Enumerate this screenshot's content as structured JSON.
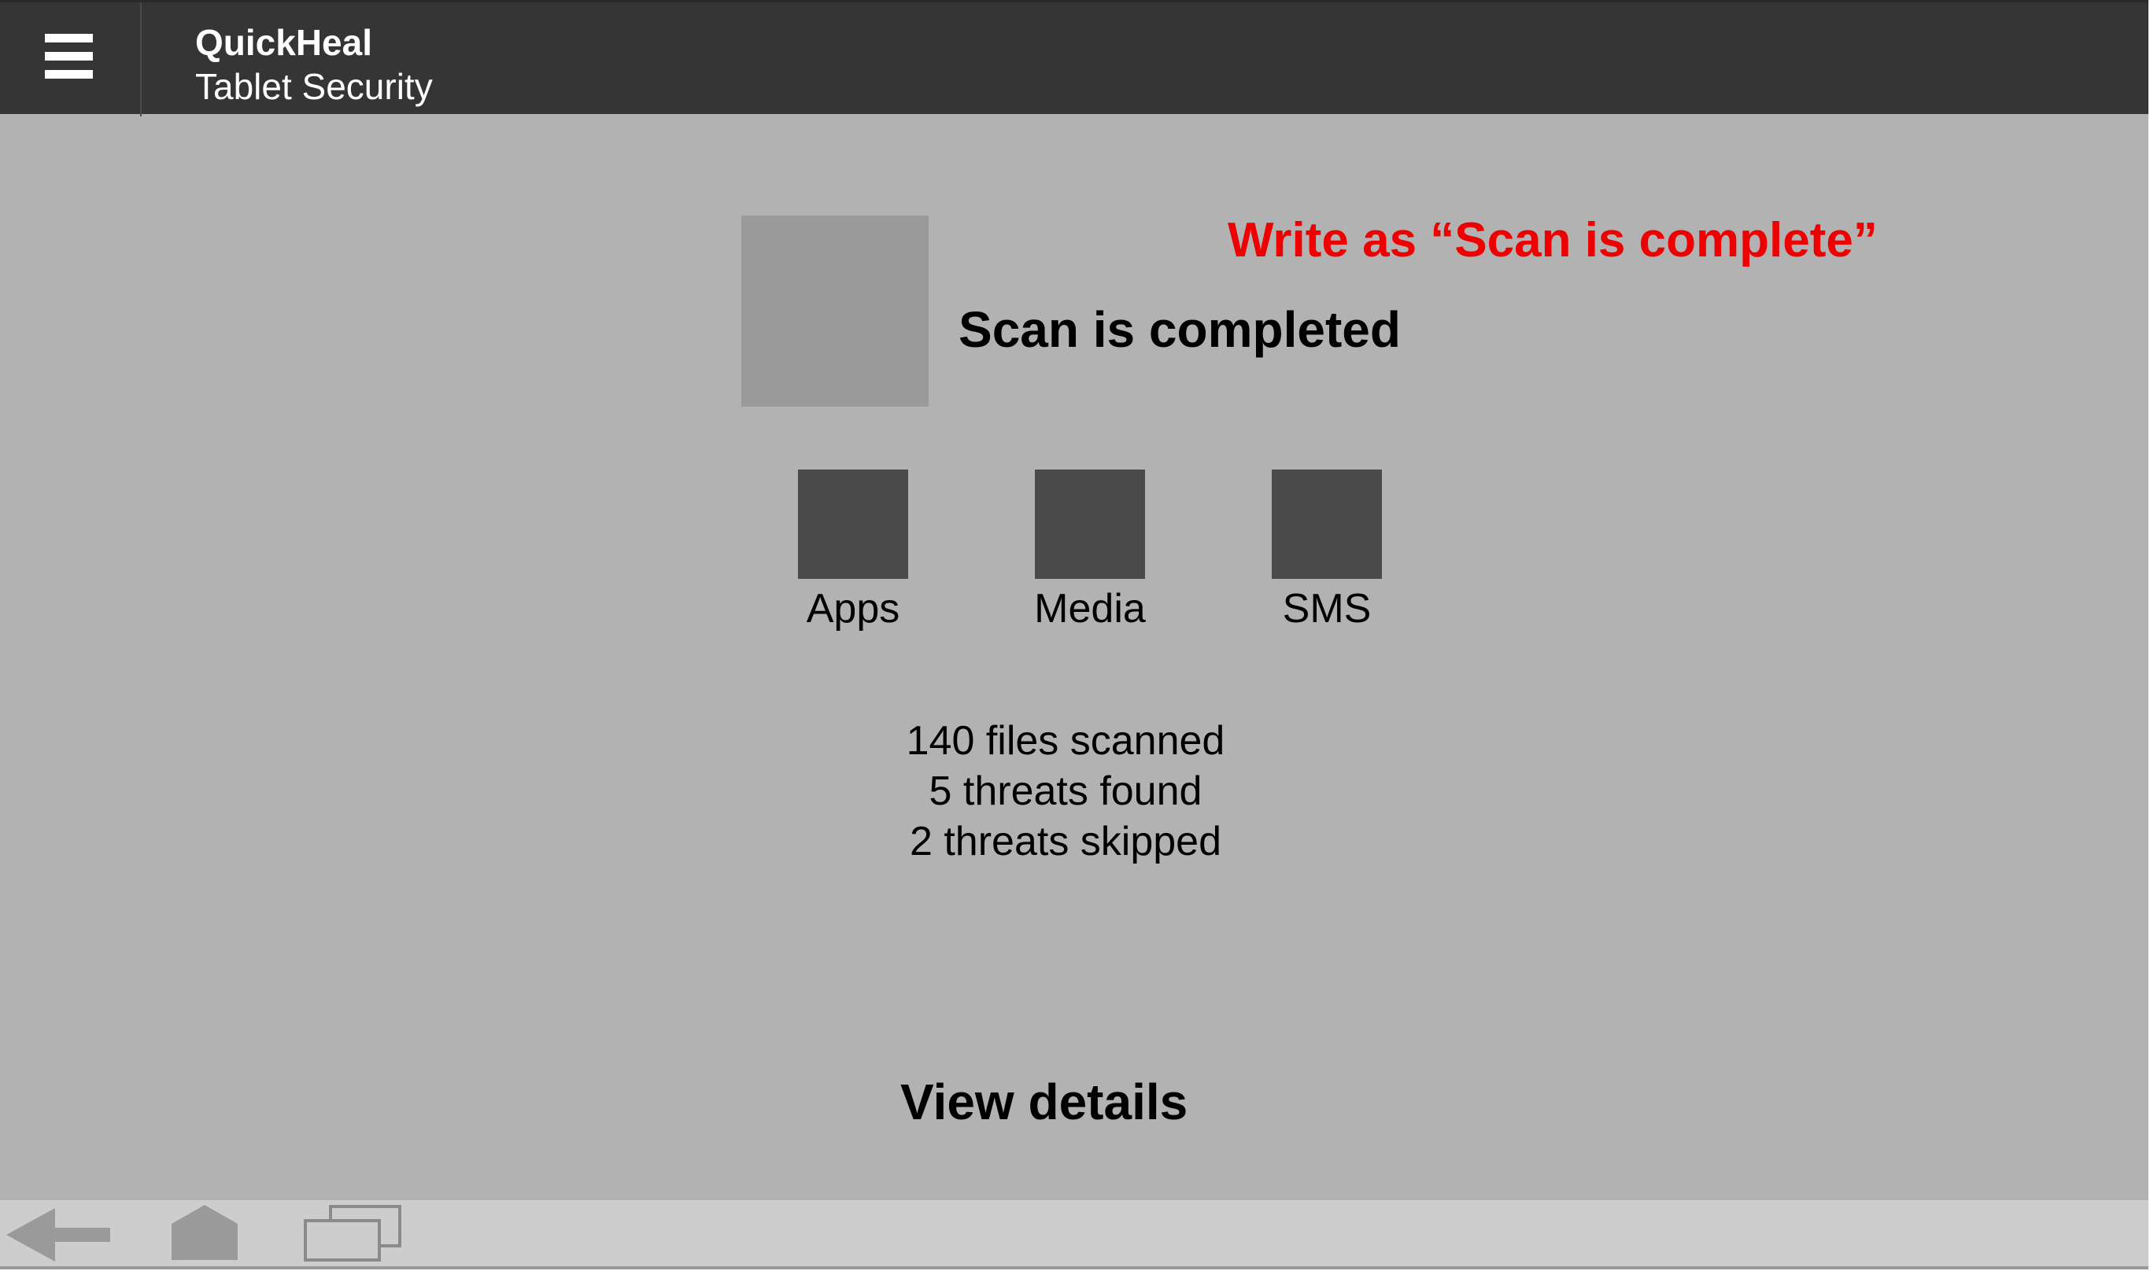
{
  "header": {
    "title": "QuickHeal",
    "subtitle": "Tablet Security",
    "menu_icon": "hamburger-menu-icon"
  },
  "scan_result": {
    "title": "Scan is completed",
    "annotation": "Write as “Scan is complete”"
  },
  "categories": [
    {
      "label": "Apps"
    },
    {
      "label": "Media"
    },
    {
      "label": "SMS"
    }
  ],
  "stats": {
    "files_scanned": "140 files scanned",
    "threats_found": "5 threats found",
    "threats_skipped": "2 threats skipped"
  },
  "actions": {
    "view_details": "View details"
  },
  "navbar": {
    "icons": [
      "back-icon",
      "home-icon",
      "recent-apps-icon"
    ]
  },
  "colors": {
    "header_bg": "#353535",
    "screen_bg": "#b2b2b2",
    "annotation": "#ee0000",
    "navbar_bg": "#cdcdcd",
    "category_icon": "#4a4a4a"
  }
}
